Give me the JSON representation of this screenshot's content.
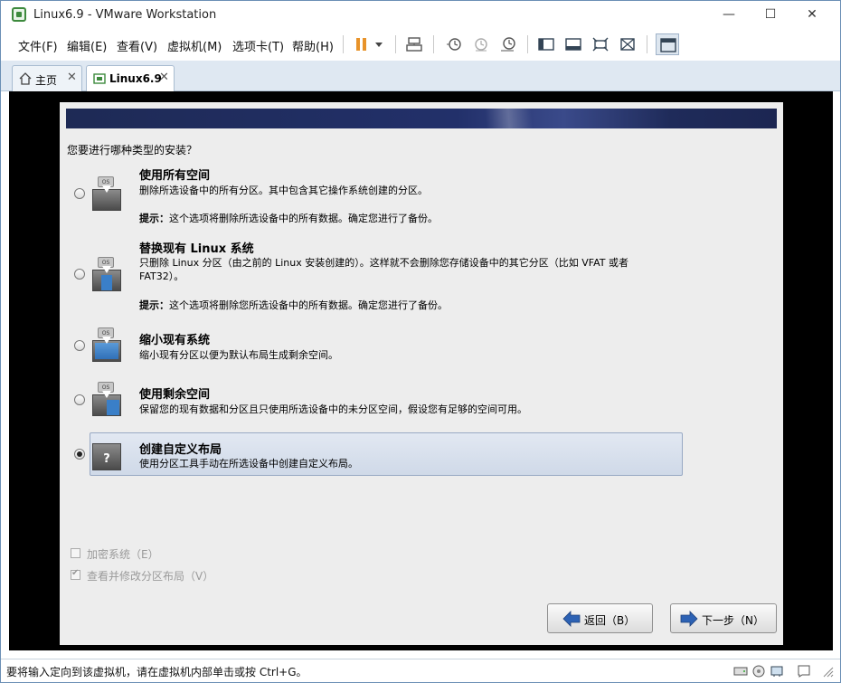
{
  "window": {
    "title": "Linux6.9 - VMware Workstation",
    "minimize": "—",
    "maximize": "☐",
    "close": "✕"
  },
  "menu": {
    "file": "文件(F)",
    "edit": "编辑(E)",
    "view": "查看(V)",
    "vm": "虚拟机(M)",
    "tabs": "选项卡(T)",
    "help": "帮助(H)"
  },
  "tabs": {
    "home": "主页",
    "vm": "Linux6.9",
    "close": "✕"
  },
  "installer": {
    "question": "您要进行哪种类型的安装？",
    "options": [
      {
        "title": "使用所有空间",
        "desc": "删除所选设备中的所有分区。其中包含其它操作系统创建的分区。",
        "hint_label": "提示：",
        "hint": "这个选项将删除所选设备中的所有数据。确定您进行了备份。"
      },
      {
        "title": "替换现有 Linux 系统",
        "desc": "只删除 Linux 分区（由之前的 Linux 安装创建的）。这样就不会删除您存储设备中的其它分区（比如 VFAT 或者 FAT32）。",
        "hint_label": "提示：",
        "hint": "这个选项将删除您所选设备中的所有数据。确定您进行了备份。"
      },
      {
        "title": "缩小现有系统",
        "desc": "缩小现有分区以便为默认布局生成剩余空间。"
      },
      {
        "title": "使用剩余空间",
        "desc": "保留您的现有数据和分区且只使用所选设备中的未分区空间，假设您有足够的空间可用。"
      },
      {
        "title": "创建自定义布局",
        "desc": "使用分区工具手动在所选设备中创建自定义布局。"
      }
    ],
    "disk_label": "OS",
    "disk_custom_mark": "?",
    "selected_index": 4,
    "encrypt_label": "加密系统（E）",
    "encrypt_checked": false,
    "review_label": "查看并修改分区布局（V）",
    "review_checked": true,
    "back_button": "返回（B）",
    "next_button": "下一步（N）"
  },
  "status": {
    "text": "要将输入定向到该虚拟机，请在虚拟机内部单击或按 Ctrl+G。"
  },
  "colors": {
    "banner": "#1e2a55",
    "accent_blue": "#3a7fc8",
    "selection": "#cfd9e8"
  }
}
